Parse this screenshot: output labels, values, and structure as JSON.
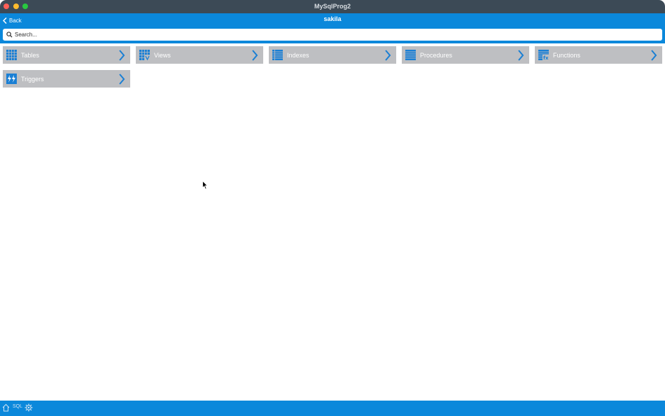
{
  "window": {
    "title": "MySqlProg2"
  },
  "nav": {
    "back_label": "Back",
    "title": "sakila"
  },
  "search": {
    "placeholder": "Search..."
  },
  "tiles": [
    {
      "label": "Tables",
      "icon": "table-grid-icon"
    },
    {
      "label": "Views",
      "icon": "view-grid-icon"
    },
    {
      "label": "Indexes",
      "icon": "index-list-icon"
    },
    {
      "label": "Procedures",
      "icon": "procedure-list-icon"
    },
    {
      "label": "Functions",
      "icon": "function-fx-icon"
    },
    {
      "label": "Triggers",
      "icon": "trigger-icon"
    }
  ],
  "bottom_bar": {
    "home_icon": "home-icon",
    "sql_label": "SQL",
    "settings_icon": "gear-icon"
  },
  "colors": {
    "accent": "#0b88db",
    "tile_bg": "#bebfc2",
    "titlebar": "#3c4a56",
    "icon_blue": "#1a7fd4"
  }
}
